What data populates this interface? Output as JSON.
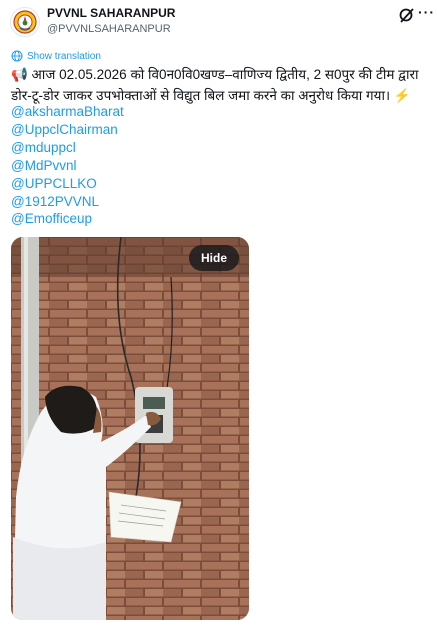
{
  "author": {
    "display_name": "PVVNL SAHARANPUR",
    "handle": "@PVVNLSAHARANPUR",
    "avatar_icon": "emblem-avatar-icon"
  },
  "actions": {
    "grok_icon": "grok-icon",
    "more_label": "···"
  },
  "translation": {
    "label": "Show translation",
    "icon": "globe-icon"
  },
  "tweet": {
    "line1": "📢 आज 02.05.2026 को वि0न0वि0खण्ड–वाणिज्य द्वितीय, 2 स0पुर की टीम द्वारा",
    "line2": "डोर-टू-डोर जाकर उपभोक्ताओं से विद्युत बिल जमा करने का अनुरोध किया गया। ⚡",
    "mentions": [
      "@aksharmaBharat",
      "@UppclChairman",
      "@mduppcl",
      " @MdPvvnl",
      "@UPPCLLKO",
      " @1912PVVNL",
      " @Emofficeup"
    ]
  },
  "media": {
    "hide_label": "Hide",
    "description_icon": "photo-meter-reading"
  },
  "colors": {
    "link": "#1d9bf0",
    "text": "#0f1419",
    "secondary": "#536471"
  }
}
